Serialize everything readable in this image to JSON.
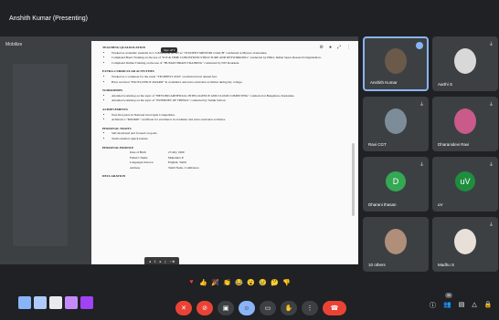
{
  "header": {
    "presenter_title": "Anshith Kumar (Presenting)"
  },
  "stage": {
    "label": "Mobilize",
    "chip": "Sign off ▾",
    "tools": [
      "⚙",
      "●",
      "⤢",
      "⋮"
    ],
    "pager": {
      "prev": "◂",
      "page": "1",
      "next": "▸",
      "sep": "|",
      "zoom": "−  ⊕"
    }
  },
  "document": {
    "sections": [
      {
        "title": "Teaching Qualification",
        "items": [
          "Worked as academic assistant in C.S.Education at NIT as \"STUDENT MENTOR COACH\" conducted at Mysore, Karnataka.",
          "Completed Basic Training on the use of \"ICE & TIME CONCEPTION STRUCTURE AND NETWORKING\" conducted by ISRO, Indian Space Research Organisation.",
          "Completed Online Training on the use of \"HUMAN BRAIN TRAINING\" conducted by NIT Rourkela."
        ]
      },
      {
        "title": "Extra-Curricular Activities",
        "items": [
          "Worked as a volunteer for the event \"TECHFEST 2019\" a technical level annual fest.",
          "Have received \"EXCELLENCE AWARD\" in academics and extra-curricular activities during my college."
        ]
      },
      {
        "title": "Workshops",
        "items": [
          "Attended workshop on the topic of \"BEYOND ARTIFICIAL INTELLIGENCE AND CLOUD COMPUTING\" conducted at Bengaluru, Karnataka.",
          "Attended workshop on the topic of \"INTERNET OF THINGS\" conducted by Sainik School."
        ]
      },
      {
        "title": "Achievements",
        "items": [
          "Won first prize in National level Quiz Competition.",
          "Achieved a \"ROOKIE\" certificate for excellence in academic and extra-curricular activities."
        ]
      },
      {
        "title": "Personal Traits",
        "items": [
          "Self-motivated and focused on goals.",
          "Team oriented. Quick learner."
        ]
      }
    ],
    "profile_title": "Personal Profile",
    "profile": [
      {
        "k": "Date of Birth",
        "v": "23 July 1999"
      },
      {
        "k": "Father's Name",
        "v": "Mahendra P."
      },
      {
        "k": "Languages Known",
        "v": "English, Tamil"
      },
      {
        "k": "Address",
        "v": "Tamil Nadu, Coimbatore"
      }
    ],
    "declaration_title": "Declaration"
  },
  "tiles": [
    {
      "name": "Anshith Kumar",
      "kind": "photo",
      "color": "#6b5a4a",
      "speaking": true
    },
    {
      "name": "Aarthi S",
      "kind": "photo",
      "color": "#d8d8d8",
      "mic": "⏚"
    },
    {
      "name": "Ravi CGT",
      "kind": "photo",
      "color": "#7c8c99",
      "mic": "⏚"
    },
    {
      "name": "Dharanidevi Ravi",
      "kind": "photo",
      "color": "#c95a8a",
      "mic": "⏚"
    },
    {
      "name": "Dharani thasan",
      "kind": "letter",
      "letter": "D",
      "color": "#34a853",
      "mic": "⏚"
    },
    {
      "name": "uV",
      "kind": "letter",
      "letter": "uV",
      "color": "#1e8e3e",
      "mic": "⏚"
    },
    {
      "name": "10 others",
      "kind": "photo",
      "color": "#b08f7a",
      "mic": ""
    },
    {
      "name": "Madhu S",
      "kind": "photo",
      "color": "#e8e0d8",
      "mic": "⏚"
    }
  ],
  "reactions": [
    {
      "glyph": "♥",
      "color": "#ea4335"
    },
    {
      "glyph": "👍",
      "color": "#f9ab00"
    },
    {
      "glyph": "🎉",
      "color": "#f9ab00"
    },
    {
      "glyph": "👏",
      "color": "#f9ab00"
    },
    {
      "glyph": "😂",
      "color": "#f9ab00"
    },
    {
      "glyph": "😮",
      "color": "#f9ab00"
    },
    {
      "glyph": "😢",
      "color": "#f9ab00"
    },
    {
      "glyph": "🤔",
      "color": "#f9ab00"
    },
    {
      "glyph": "👎",
      "color": "#f9ab00"
    }
  ],
  "controls": [
    {
      "name": "mic-off-button",
      "glyph": "✕",
      "style": "red"
    },
    {
      "name": "camera-off-button",
      "glyph": "⊘",
      "style": "red"
    },
    {
      "name": "captions-button",
      "glyph": "▣",
      "style": ""
    },
    {
      "name": "reactions-button",
      "glyph": "☺",
      "style": "blue"
    },
    {
      "name": "present-button",
      "glyph": "▭",
      "style": ""
    },
    {
      "name": "raise-hand-button",
      "glyph": "✋",
      "style": ""
    },
    {
      "name": "more-options-button",
      "glyph": "⋮",
      "style": ""
    },
    {
      "name": "leave-call-button",
      "glyph": "☎",
      "style": "end"
    }
  ],
  "apps": [
    {
      "color": "#8ab4f8"
    },
    {
      "color": "#aecbfa"
    },
    {
      "color": "#e8eaed"
    },
    {
      "color": "#c58af9"
    },
    {
      "color": "#a142f4"
    }
  ],
  "right_tools": [
    {
      "name": "info-icon",
      "glyph": "ⓘ"
    },
    {
      "name": "people-icon",
      "glyph": "👥"
    },
    {
      "name": "chat-icon",
      "glyph": "▤"
    },
    {
      "name": "activities-icon",
      "glyph": "△"
    },
    {
      "name": "lock-icon",
      "glyph": "🔒"
    }
  ],
  "people_count": "30"
}
